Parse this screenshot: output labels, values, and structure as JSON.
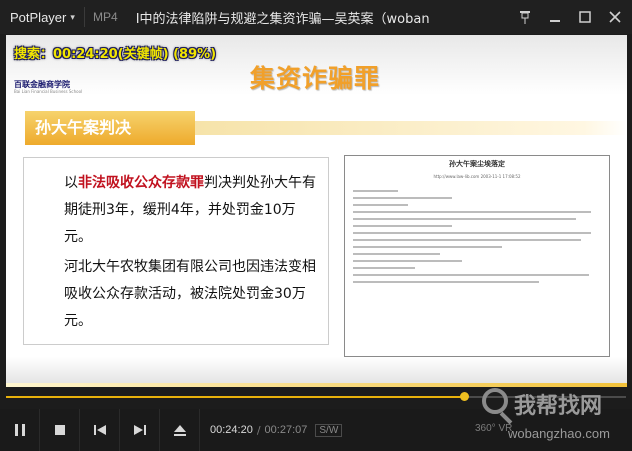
{
  "app": {
    "brand": "PotPlayer",
    "format": "MP4",
    "title": "I中的法律陷阱与规避之集资诈骗—吴英案（woban"
  },
  "osd": "搜索：00:24:20(关键帧) (89%)",
  "slide": {
    "logo": "百联金融商学院",
    "logo_sub": "Bai Lian Financial Business School",
    "title": "集资诈骗罪",
    "case_label": "孙大午案判决",
    "p1_prefix": "以",
    "p1_red": "非法吸收公众存款罪",
    "p1_rest": "判决判处孙大午有期徒刑3年，缓刑4年，并处罚金10万元。",
    "p2": "河北大午农牧集团有限公司也因违法变相吸收公众存款活动，被法院处罚金30万元。",
    "doc_title": "孙大午案尘埃落定",
    "doc_meta": "http://www.law-lib.com   2003-11-1 17:08:52"
  },
  "progress": {
    "fraction": 0.738
  },
  "controls": {
    "time_current": "00:24:20",
    "time_total": "00:27:07",
    "sw": "S/W",
    "vr": "360° VR"
  },
  "watermark": {
    "text": "我帮找网",
    "url": "wobangzhao.com"
  },
  "colors": {
    "accent": "#e8b10b",
    "title_orange": "#f1a02a",
    "red_text": "#c1121f"
  }
}
